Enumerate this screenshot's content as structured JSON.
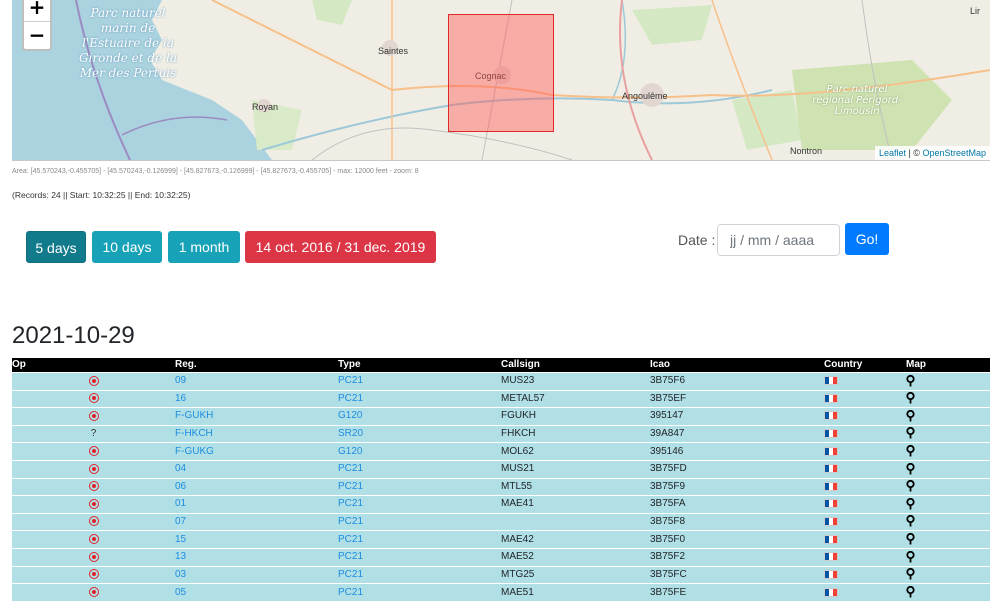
{
  "map": {
    "zoom_in": "+",
    "zoom_out": "−",
    "marine_park_label": "Parc naturel marin de l'Estuaire de la Gironde et de la Mer des Pertuis",
    "regional_park_label": "Parc naturel régional Périgord-Limousin",
    "cities": {
      "saintes": "Saintes",
      "royan": "Royan",
      "cognac": "Cognac",
      "angouleme": "Angoulême",
      "nontron": "Nontron",
      "lir": "Lir"
    },
    "attribution_leaflet": "Leaflet",
    "attribution_sep": " | © ",
    "attribution_osm": "OpenStreetMap"
  },
  "area_info": "Area: [45.570243,-0.455705] - [45.570243,-0.126999] - [45.827673,-0.126999] - [45.827673,-0.455705] - max: 12000 feet - zoom: 8",
  "records_info": "(Records: 24 || Start: 10:32:25 || End: 10:32:25)",
  "buttons": {
    "five_days": "5 days",
    "ten_days": "10 days",
    "one_month": "1 month",
    "range": "14 oct. 2016 / 31 dec. 2019"
  },
  "date_filter": {
    "label": "Date :",
    "placeholder": "jj / mm / aaaa",
    "go": "Go!"
  },
  "date_heading": "2021-10-29",
  "table": {
    "headers": [
      "Op",
      "Reg.",
      "Type",
      "Callsign",
      "Icao",
      "Country",
      "Map"
    ],
    "rows": [
      {
        "op": "target",
        "reg": "09",
        "type": "PC21",
        "callsign": "MUS23",
        "icao": "3B75F6"
      },
      {
        "op": "target",
        "reg": "16",
        "type": "PC21",
        "callsign": "METAL57",
        "icao": "3B75EF"
      },
      {
        "op": "target",
        "reg": "F-GUKH",
        "type": "G120",
        "callsign": "FGUKH",
        "icao": "395147"
      },
      {
        "op": "?",
        "reg": "F-HKCH",
        "type": "SR20",
        "callsign": "FHKCH",
        "icao": "39A847"
      },
      {
        "op": "target",
        "reg": "F-GUKG",
        "type": "G120",
        "callsign": "MOL62",
        "icao": "395146"
      },
      {
        "op": "target",
        "reg": "04",
        "type": "PC21",
        "callsign": "MUS21",
        "icao": "3B75FD"
      },
      {
        "op": "target",
        "reg": "06",
        "type": "PC21",
        "callsign": "MTL55",
        "icao": "3B75F9"
      },
      {
        "op": "target",
        "reg": "01",
        "type": "PC21",
        "callsign": "MAE41",
        "icao": "3B75FA"
      },
      {
        "op": "target",
        "reg": "07",
        "type": "PC21",
        "callsign": "",
        "icao": "3B75F8"
      },
      {
        "op": "target",
        "reg": "15",
        "type": "PC21",
        "callsign": "MAE42",
        "icao": "3B75F0"
      },
      {
        "op": "target",
        "reg": "13",
        "type": "PC21",
        "callsign": "MAE52",
        "icao": "3B75F2"
      },
      {
        "op": "target",
        "reg": "03",
        "type": "PC21",
        "callsign": "MTG25",
        "icao": "3B75FC"
      },
      {
        "op": "target",
        "reg": "05",
        "type": "PC21",
        "callsign": "MAE51",
        "icao": "3B75FE"
      }
    ]
  },
  "icons": {
    "op": "target-icon",
    "country": "france-flag-icon",
    "map": "map-pin-icon"
  },
  "colors": {
    "row_bg": "#b0e0e6",
    "header_bg": "#000000",
    "link": "#1d8ce0",
    "op_icon": "#e0242a",
    "btn_teal": "#17a2b8",
    "btn_teal_active": "#117a8b",
    "btn_red": "#dc3545",
    "btn_blue": "#007bff",
    "selection": "#e02a2a"
  }
}
